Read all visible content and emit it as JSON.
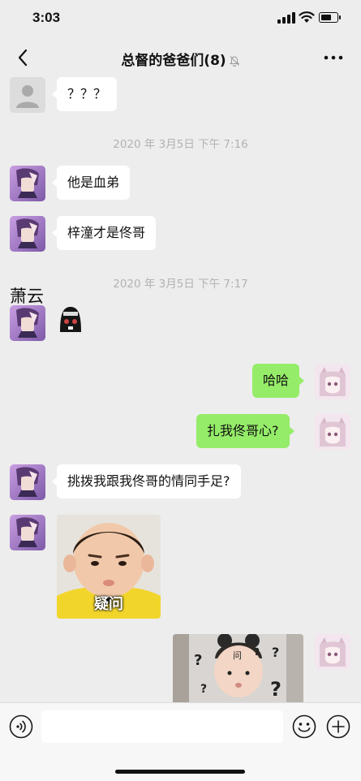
{
  "status_bar": {
    "time": "3:03"
  },
  "header": {
    "title": "总督的爸爸们(8)"
  },
  "messages": {
    "m0": {
      "text": "？？？"
    },
    "t1": {
      "text": "2020 年 3月5日 下午 7:16"
    },
    "m1": {
      "text": "他是血弟"
    },
    "m2": {
      "text": "梓潼才是佟哥"
    },
    "t2": {
      "text": "2020 年 3月5日 下午 7:17"
    },
    "sender_name": {
      "text": "萧云"
    },
    "m4": {
      "text": "哈哈"
    },
    "m5": {
      "text": "扎我佟哥心?"
    },
    "m6": {
      "text": "挑拨我跟我佟哥的情同手足?"
    },
    "m7": {
      "caption": "疑问"
    },
    "m8": {
      "forehead_text": "问"
    }
  },
  "input": {
    "value": "",
    "placeholder": ""
  },
  "colors": {
    "background": "#ededed",
    "incoming_bubble": "#ffffff",
    "outgoing_bubble": "#95ec69",
    "timestamp": "#b2b2b2",
    "input_bar": "#f7f7f7"
  },
  "icons": [
    "back-arrow-icon",
    "mute-bell-icon",
    "more-icon",
    "voice-icon",
    "emoji-icon",
    "plus-icon"
  ]
}
